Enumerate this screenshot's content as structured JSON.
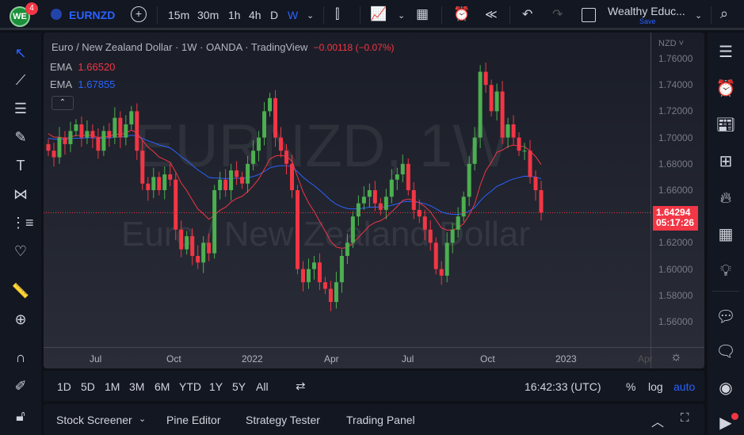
{
  "topbar": {
    "notif_count": "4",
    "logo": "WE",
    "symbol": "EURNZD",
    "intervals": [
      "15m",
      "30m",
      "1h",
      "4h",
      "D",
      "W"
    ],
    "layout_name": "Wealthy Educ...",
    "save_label": "Save"
  },
  "legend": {
    "title": "Euro / New Zealand Dollar · 1W · OANDA · TradingView",
    "change": "−0.00118 (−0.07%)",
    "ema1_label": "EMA",
    "ema1_value": "1.66520",
    "ema2_label": "EMA",
    "ema2_value": "1.67855"
  },
  "watermark": {
    "symbol": "EURNZD, 1W",
    "name": "Euro / New Zealand Dollar"
  },
  "price_axis": {
    "currency": "NZD",
    "ticks": [
      "1.76000",
      "1.74000",
      "1.72000",
      "1.70000",
      "1.68000",
      "1.66000",
      "1.62000",
      "1.60000",
      "1.58000",
      "1.56000"
    ],
    "last_price": "1.64294",
    "countdown": "05:17:26"
  },
  "time_axis": [
    "Jul",
    "Oct",
    "2022",
    "Apr",
    "Jul",
    "Oct",
    "2023",
    "Apr"
  ],
  "bottom_toolbar": {
    "ranges": [
      "1D",
      "5D",
      "1M",
      "3M",
      "6M",
      "YTD",
      "1Y",
      "5Y",
      "All"
    ],
    "clock": "16:42:33 (UTC)",
    "percent": "%",
    "log": "log",
    "auto": "auto"
  },
  "panel_tabs": [
    "Stock Screener",
    "Pine Editor",
    "Strategy Tester",
    "Trading Panel"
  ],
  "colors": {
    "up": "#26a69a",
    "down": "#ef5350",
    "bull": "#4caf50",
    "bear": "#f23645",
    "ema_fast": "#f23645",
    "ema_slow": "#2962ff",
    "accent": "#2962ff"
  },
  "chart_data": {
    "type": "candlestick",
    "ylim": [
      1.55,
      1.765
    ],
    "closes": [
      1.69,
      1.685,
      1.7,
      1.695,
      1.705,
      1.71,
      1.7,
      1.705,
      1.7,
      1.69,
      1.705,
      1.7,
      1.715,
      1.7,
      1.71,
      1.72,
      1.69,
      1.665,
      1.66,
      1.67,
      1.66,
      1.672,
      1.668,
      1.63,
      1.615,
      1.625,
      1.61,
      1.605,
      1.62,
      1.612,
      1.66,
      1.668,
      1.66,
      1.675,
      1.67,
      1.665,
      1.68,
      1.69,
      1.7,
      1.72,
      1.73,
      1.7,
      1.69,
      1.68,
      1.66,
      1.6,
      1.59,
      1.6,
      1.605,
      1.59,
      1.585,
      1.575,
      1.59,
      1.61,
      1.62,
      1.64,
      1.65,
      1.655,
      1.66,
      1.65,
      1.645,
      1.655,
      1.668,
      1.672,
      1.68,
      1.66,
      1.645,
      1.64,
      1.63,
      1.62,
      1.6,
      1.595,
      1.62,
      1.63,
      1.64,
      1.655,
      1.68,
      1.7,
      1.75,
      1.74,
      1.72,
      1.735,
      1.7,
      1.71,
      1.7,
      1.69,
      1.69,
      1.67,
      1.66,
      1.643
    ]
  }
}
